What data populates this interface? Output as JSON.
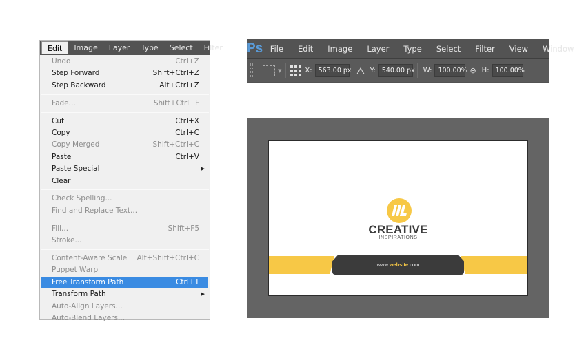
{
  "edit_menu": {
    "menubar": [
      "Edit",
      "Image",
      "Layer",
      "Type",
      "Select",
      "Filter"
    ],
    "active": "Edit",
    "groups": [
      [
        {
          "label": "Undo",
          "shortcut": "Ctrl+Z",
          "disabled": true
        },
        {
          "label": "Step Forward",
          "shortcut": "Shift+Ctrl+Z",
          "disabled": false
        },
        {
          "label": "Step Backward",
          "shortcut": "Alt+Ctrl+Z",
          "disabled": false
        }
      ],
      [
        {
          "label": "Fade...",
          "shortcut": "Shift+Ctrl+F",
          "disabled": true
        }
      ],
      [
        {
          "label": "Cut",
          "shortcut": "Ctrl+X",
          "disabled": false
        },
        {
          "label": "Copy",
          "shortcut": "Ctrl+C",
          "disabled": false
        },
        {
          "label": "Copy Merged",
          "shortcut": "Shift+Ctrl+C",
          "disabled": true
        },
        {
          "label": "Paste",
          "shortcut": "Ctrl+V",
          "disabled": false
        },
        {
          "label": "Paste Special",
          "shortcut": "",
          "disabled": false,
          "submenu": true
        },
        {
          "label": "Clear",
          "shortcut": "",
          "disabled": false
        }
      ],
      [
        {
          "label": "Check Spelling...",
          "shortcut": "",
          "disabled": true
        },
        {
          "label": "Find and Replace Text...",
          "shortcut": "",
          "disabled": true
        }
      ],
      [
        {
          "label": "Fill...",
          "shortcut": "Shift+F5",
          "disabled": true
        },
        {
          "label": "Stroke...",
          "shortcut": "",
          "disabled": true
        }
      ],
      [
        {
          "label": "Content-Aware Scale",
          "shortcut": "Alt+Shift+Ctrl+C",
          "disabled": true
        },
        {
          "label": "Puppet Warp",
          "shortcut": "",
          "disabled": true
        },
        {
          "label": "Free Transform Path",
          "shortcut": "Ctrl+T",
          "disabled": false,
          "highlight": true
        },
        {
          "label": "Transform Path",
          "shortcut": "",
          "disabled": false,
          "submenu": true
        },
        {
          "label": "Auto-Align Layers...",
          "shortcut": "",
          "disabled": true
        },
        {
          "label": "Auto-Blend Layers...",
          "shortcut": "",
          "disabled": true
        }
      ]
    ]
  },
  "ps_toolbar": {
    "logo": "Ps",
    "menu": [
      "File",
      "Edit",
      "Image",
      "Layer",
      "Type",
      "Select",
      "Filter",
      "View",
      "Window"
    ],
    "options": {
      "x_label": "X:",
      "x_value": "563.00 px",
      "y_label": "Y:",
      "y_value": "540.00 px",
      "w_label": "W:",
      "w_value": "100.00%",
      "h_label": "H:",
      "h_value": "100.00%"
    }
  },
  "card": {
    "brand_name": "CREATIVE",
    "tagline": "INSPIRATIONS",
    "url_prefix": "www.",
    "url_highlight": "website",
    "url_suffix": ".com"
  },
  "colors": {
    "accent_yellow": "#f7c846",
    "dark_gray": "#3b3b3b",
    "menu_highlight": "#3a8be2",
    "ps_logo": "#5a9bd8"
  }
}
